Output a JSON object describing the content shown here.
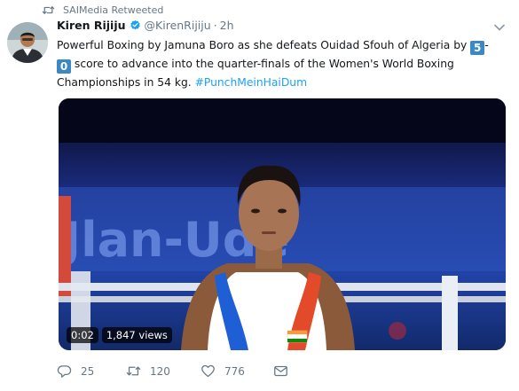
{
  "retweet_bar": {
    "icon": "retweet-icon",
    "label": "SAIMedia Retweeted"
  },
  "tweet": {
    "author_name": "Kiren Rijiju",
    "handle": "@KirenRijiju",
    "separator": "·",
    "time": "2h",
    "verified": true,
    "text": {
      "part1": "Powerful Boxing by Jamuna Boro as she defeats Ouidad Sfouh of Algeria by ",
      "emoji1": "5",
      "dash": "-",
      "emoji2": "0",
      "part2": " score to advance into the quarter-finals of the Women's World Boxing Championships in 54 kg. ",
      "hashtag": "#PunchMeinHaiDum"
    },
    "video": {
      "time": "0:02",
      "views": "1,847 views",
      "backdrop_text": "Jlan-Ude"
    },
    "actions": {
      "reply_count": "25",
      "retweet_count": "120",
      "like_count": "776"
    }
  },
  "colors": {
    "link": "#1da1f2",
    "muted": "#657786",
    "verified": "#1da1f2",
    "emoji_key": "#3b88c3"
  }
}
